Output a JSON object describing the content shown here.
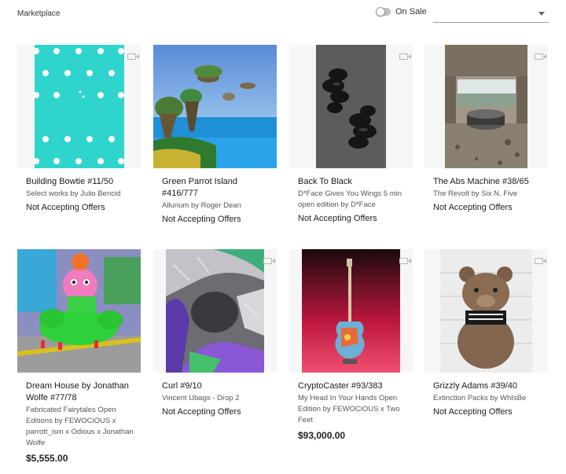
{
  "header": {
    "title": "Marketplace",
    "toggle_label": "On Sale",
    "toggle_on": false,
    "sort_select": {
      "value": ""
    }
  },
  "cards": [
    {
      "name": "Building Bowtie #11/50",
      "collection": "Select works by Julio Bencid",
      "status": "Not Accepting Offers",
      "price": "",
      "has_video": true
    },
    {
      "name": "Green Parrot Island #416/777",
      "collection": "Allurium by Roger Dean",
      "status": "Not Accepting Offers",
      "price": "",
      "has_video": false
    },
    {
      "name": "Back To Black",
      "collection": "D*Face Gives You Wings 5 min open edition by D*Face",
      "status": "Not Accepting Offers",
      "price": "",
      "has_video": true
    },
    {
      "name": "The Abs Machine #38/65",
      "collection": "The Revolt by Six N. Five",
      "status": "Not Accepting Offers",
      "price": "",
      "has_video": true
    },
    {
      "name": "Dream House by Jonathan Wolfe #77/78",
      "collection": "Fabricated Fairytales Open Editions by FEWOCiOUS x parrott_ism x Odious x Jonathan Wolfe",
      "status": "",
      "price": "$5,555.00",
      "has_video": false
    },
    {
      "name": "Curl #9/10",
      "collection": "Vincent Ubags - Drop 2",
      "status": "Not Accepting Offers",
      "price": "",
      "has_video": true
    },
    {
      "name": "CryptoCaster #93/383",
      "collection": "My Head In Your Hands Open Edition by FEWOCiOUS x Two Feet",
      "status": "",
      "price": "$93,000.00",
      "has_video": true
    },
    {
      "name": "Grizzly Adams #39/40",
      "collection": "Extinction Packs by WhIsBe",
      "status": "Not Accepting Offers",
      "price": "",
      "has_video": true
    }
  ]
}
